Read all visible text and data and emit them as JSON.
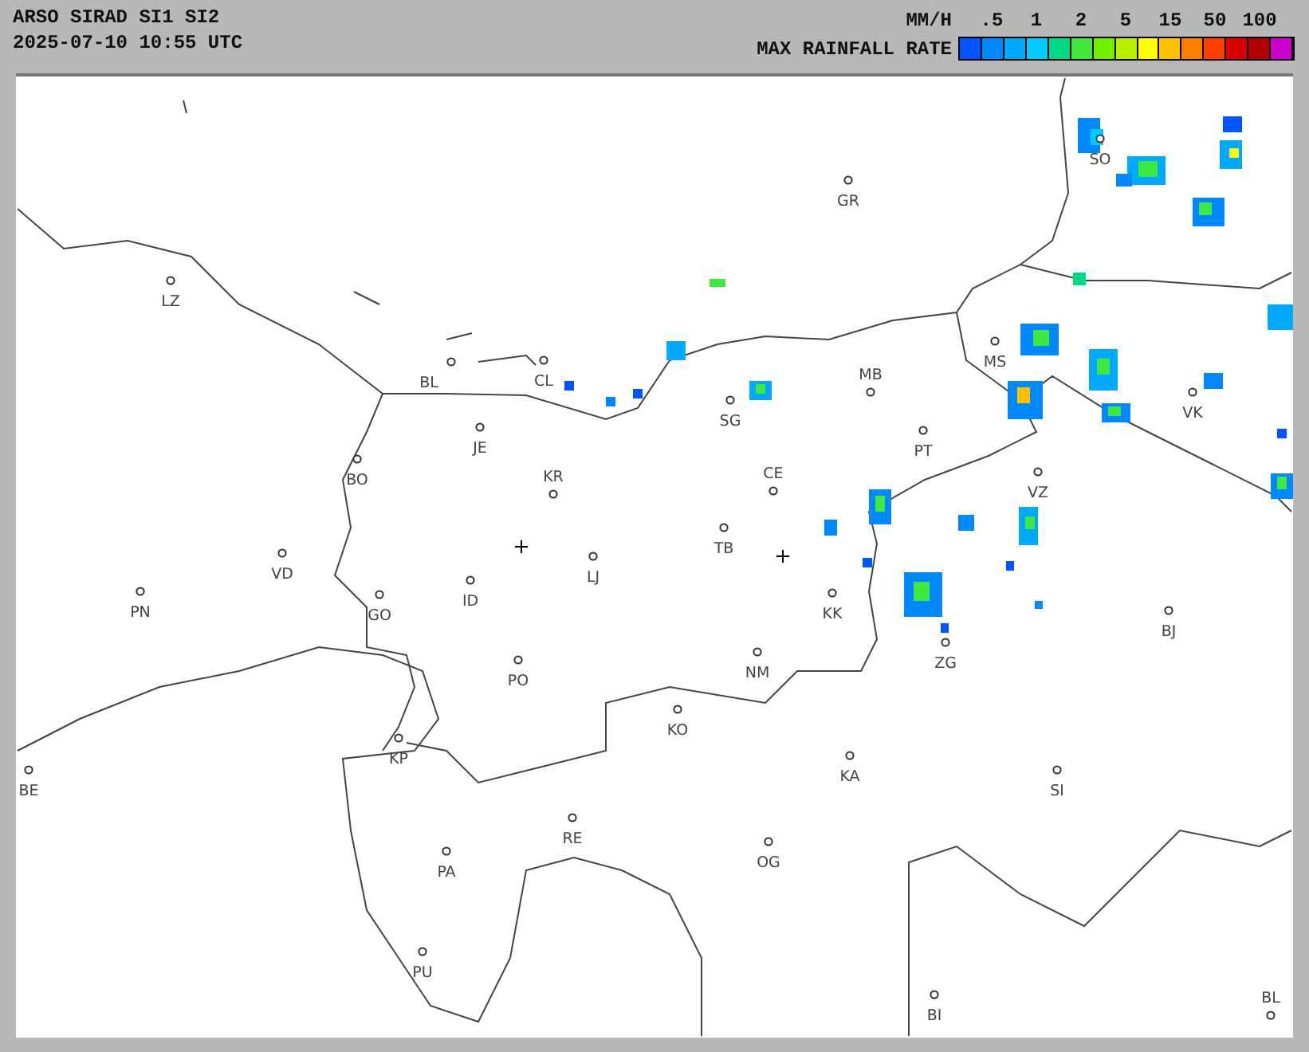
{
  "header": {
    "title": "ARSO SIRAD SI1 SI2",
    "timestamp": "2025-07-10 10:55 UTC"
  },
  "legend": {
    "unit": "MM/H",
    "title": "MAX RAINFALL RATE",
    "ticks": [
      ".5",
      "1",
      "2",
      "5",
      "15",
      "50",
      "100"
    ],
    "swatches": [
      {
        "color": "#0055ff"
      },
      {
        "color": "#0088ff"
      },
      {
        "color": "#00aaff"
      },
      {
        "color": "#00ccff"
      },
      {
        "color": "#00d888"
      },
      {
        "color": "#40e840"
      },
      {
        "color": "#70f000"
      },
      {
        "color": "#b8f000"
      },
      {
        "color": "#ffff00"
      },
      {
        "color": "#ffc000"
      },
      {
        "color": "#ff8000"
      },
      {
        "color": "#ff4000"
      },
      {
        "color": "#d80000"
      },
      {
        "color": "#b00000"
      },
      {
        "color": "#cc00cc"
      }
    ]
  },
  "map": {
    "cities": [
      "GR",
      "SO",
      "LZ",
      "BL",
      "CL",
      "MB",
      "SG",
      "JE",
      "PT",
      "MS",
      "VK",
      "BO",
      "KR",
      "CE",
      "VZ",
      "TB",
      "LJ",
      "VD",
      "ID",
      "PN",
      "GO",
      "KK",
      "BJ",
      "ZG",
      "NM",
      "PO",
      "KO",
      "KP",
      "KA",
      "SI",
      "BE",
      "RE",
      "OG",
      "PA",
      "PU",
      "BI",
      "BL"
    ]
  }
}
